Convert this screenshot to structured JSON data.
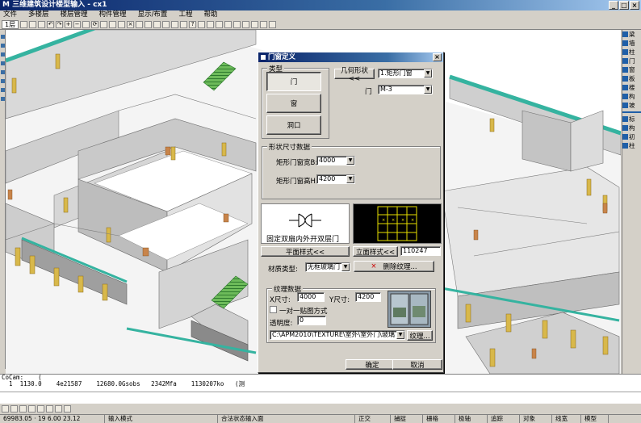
{
  "window": {
    "title": "M 三维建筑设计楼型输入 - cx1"
  },
  "menu": [
    "文件",
    "多楼层",
    "楼层管理",
    "构件管理",
    "显示/布置",
    "工程",
    "帮助"
  ],
  "toolbar": {
    "floor_label": "1层",
    "icons": [
      "new-icon",
      "open-icon",
      "save-icon",
      "undo-icon",
      "redo-icon",
      "zoom-in-icon",
      "zoom-out-icon",
      "pan-icon",
      "rotate-icon",
      "select-icon",
      "move-icon",
      "copy-icon",
      "delete-icon",
      "mirror-icon",
      "measure-icon",
      "grid-icon",
      "layer-icon",
      "render-icon",
      "print-icon",
      "help-icon"
    ]
  },
  "right_panel": {
    "items": [
      "梁",
      "墙",
      "柱",
      "门",
      "窗",
      "板",
      "楼",
      "构",
      "坡",
      "标",
      "构",
      "初",
      "柱"
    ]
  },
  "dialog": {
    "title": "门窗定义",
    "category_group_label": "类型",
    "category_buttons": [
      "门",
      "窗",
      "洞口"
    ],
    "selected_category": "门",
    "geometry_button": "几何形状<<",
    "geometry_value": "1.矩形门窗",
    "door_label": "门",
    "door_value": "M-3",
    "dimension_group_label": "形状尺寸数据",
    "width_label": "矩形门窗宽B:",
    "width_value": "4000",
    "height_label": "矩形门窗高H:",
    "height_value": "4200",
    "preview_caption": "固定双扇内外开双层门",
    "plan_style_button": "平面样式<<",
    "elevation_style_button": "立面样式<<",
    "elevation_code": "110247",
    "material_type_label": "材质类型:",
    "material_type_value": "无框玻璃门",
    "delete_texture_button": "删除纹理...",
    "texture_group_label": "纹理数据",
    "x_size_label": "X尺寸:",
    "x_size_value": "4000",
    "y_size_label": "Y尺寸:",
    "y_size_value": "4200",
    "one_to_one_label": "一对一贴图方式",
    "transparency_label": "透明度:",
    "transparency_value": "0",
    "texture_path": "C:\\APM2010\\TEXTURE\\室外\\室外门\\玻璃下框",
    "texture_button": "纹理...",
    "ok_button": "确定",
    "cancel_button": "取消"
  },
  "command_lines": [
    "CoCam:    (",
    "  1  1130.0    4e21587    12680.0Gsobs   2342Mfa    1130207ko   (测",
    ""
  ],
  "command_input": "",
  "bottom_icons": [
    "axis-icon",
    "osnap-icon",
    "ortho-icon",
    "polar-icon",
    "grid-toggle-icon",
    "layer-toggle-icon",
    "pen-icon",
    "view-icon"
  ],
  "status": {
    "coords": "69983.05 · 19 6.00 23.12",
    "mode": "输入模式",
    "hint": "合法状态输入面",
    "cells": [
      "正交",
      "捕捉",
      "栅格",
      "极轴",
      "追踪",
      "对象",
      "线宽",
      "模型"
    ]
  },
  "colors": {
    "title_blue": "#0a246a",
    "wall_top": "#35b3a0",
    "column": "#d8b84a",
    "door": "#c8844a",
    "glass": "#4a9a4a"
  }
}
